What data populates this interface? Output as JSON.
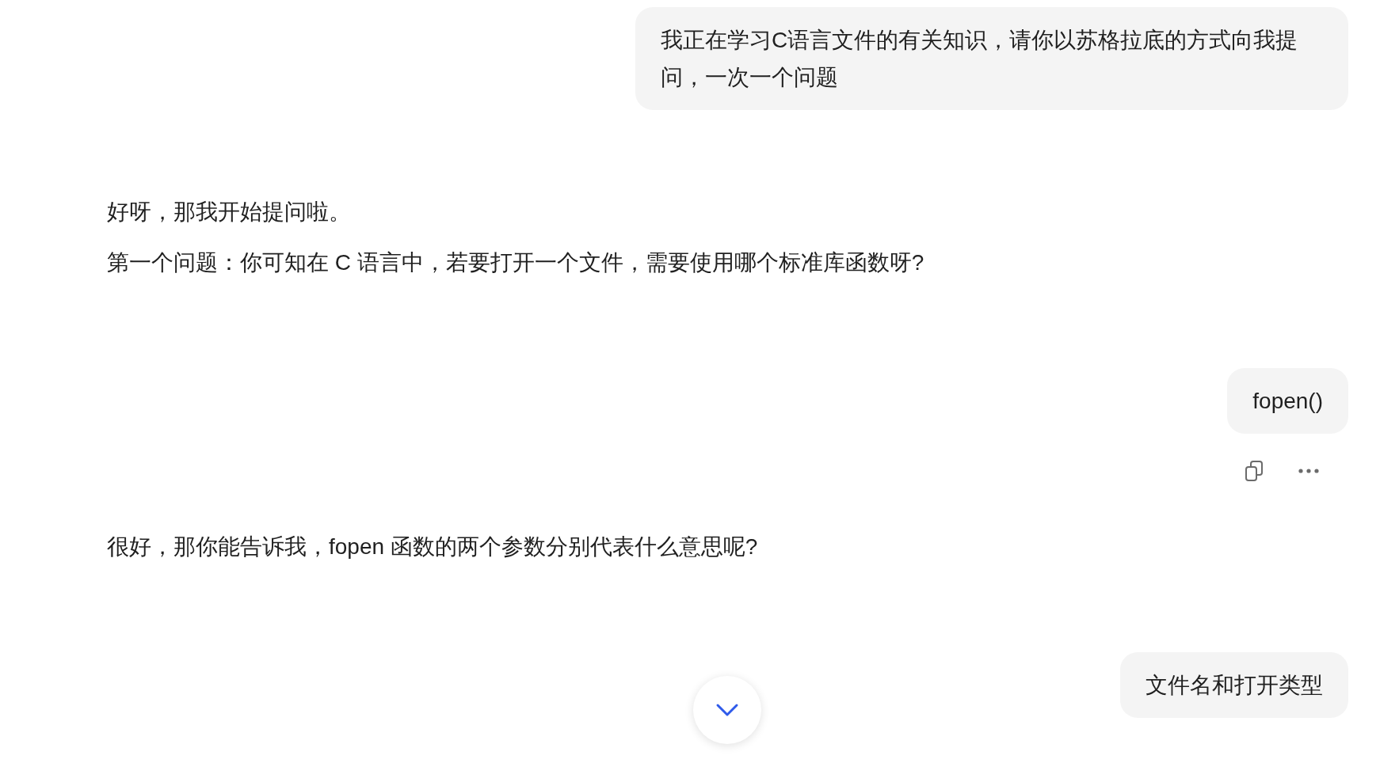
{
  "messages": [
    {
      "kind": "user",
      "text": "我正在学习C语言文件的有关知识，请你以苏格拉底的方式向我提问，一次一个问题",
      "show_actions": false
    },
    {
      "kind": "assistant",
      "paragraphs": [
        "好呀，那我开始提问啦。",
        "第一个问题：你可知在 C 语言中，若要打开一个文件，需要使用哪个标准库函数呀?"
      ]
    },
    {
      "kind": "user",
      "text": "fopen()",
      "show_actions": true
    },
    {
      "kind": "assistant",
      "paragraphs": [
        "很好，那你能告诉我，fopen 函数的两个参数分别代表什么意思呢?"
      ]
    },
    {
      "kind": "user",
      "text": "文件名和打开类型",
      "show_actions": false
    }
  ],
  "scroll_down_button": {
    "visible": true
  }
}
